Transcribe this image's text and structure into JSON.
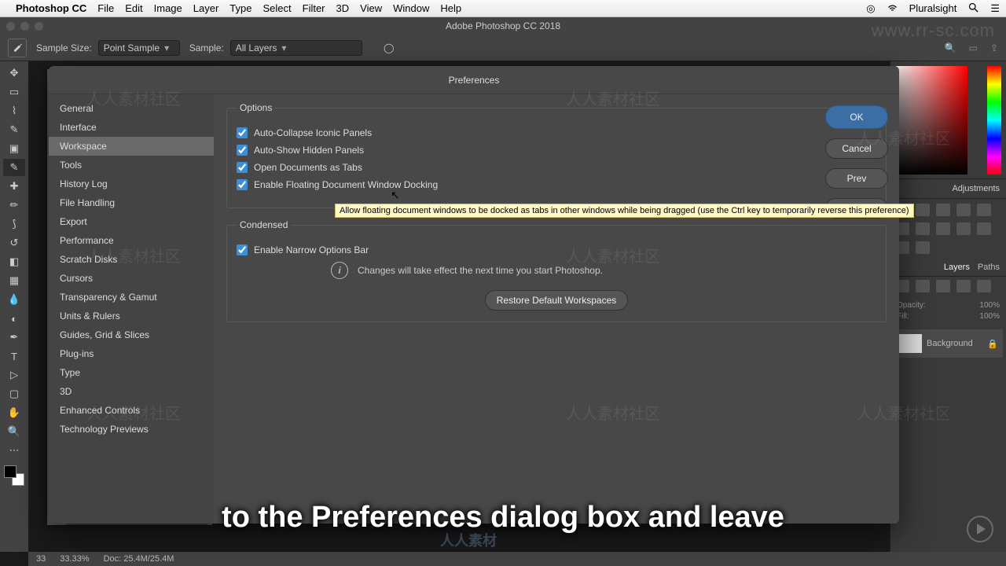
{
  "menubar": {
    "app": "Photoshop CC",
    "items": [
      "File",
      "Edit",
      "Image",
      "Layer",
      "Type",
      "Select",
      "Filter",
      "3D",
      "View",
      "Window",
      "Help"
    ],
    "right_label": "Pluralsight"
  },
  "titlebar": "Adobe Photoshop CC 2018",
  "options_bar": {
    "sample_size_label": "Sample Size:",
    "sample_size_value": "Point Sample",
    "sample_label": "Sample:",
    "sample_value": "All Layers"
  },
  "dialog": {
    "title": "Preferences",
    "sidebar": [
      "General",
      "Interface",
      "Workspace",
      "Tools",
      "History Log",
      "File Handling",
      "Export",
      "Performance",
      "Scratch Disks",
      "Cursors",
      "Transparency & Gamut",
      "Units & Rulers",
      "Guides, Grid & Slices",
      "Plug-ins",
      "Type",
      "3D",
      "Enhanced Controls",
      "Technology Previews"
    ],
    "sidebar_selected": 2,
    "options_legend": "Options",
    "checks": [
      {
        "label": "Auto-Collapse Iconic Panels",
        "checked": true
      },
      {
        "label": "Auto-Show Hidden Panels",
        "checked": true
      },
      {
        "label": "Open Documents as Tabs",
        "checked": true
      },
      {
        "label": "Enable Floating Document Window Docking",
        "checked": true
      }
    ],
    "condensed_legend": "Condensed",
    "narrow": {
      "label": "Enable Narrow Options Bar",
      "checked": true
    },
    "info": "Changes will take effect the next time you start Photoshop.",
    "restore": "Restore Default Workspaces",
    "buttons": {
      "ok": "OK",
      "cancel": "Cancel",
      "prev": "Prev",
      "next": "Next"
    },
    "tooltip": "Allow floating document windows to be docked as tabs in other windows while being dragged (use the Ctrl key to temporarily reverse this preference)"
  },
  "right_panels": {
    "adjustments": "Adjustments",
    "tabs": [
      "Layers",
      "Paths"
    ],
    "opacity_label": "Opacity:",
    "opacity_value": "100%",
    "fill_label": "Fill:",
    "fill_value": "100%",
    "layer_name": "Background"
  },
  "status": {
    "percent": "33.33%",
    "doc": "Doc: 25.4M/25.4M",
    "small": "33"
  },
  "subtitle": "to the Preferences dialog box and leave",
  "watermark": "人人素材社区",
  "site": "www.rr-sc.com",
  "center_logo": "人人素材"
}
